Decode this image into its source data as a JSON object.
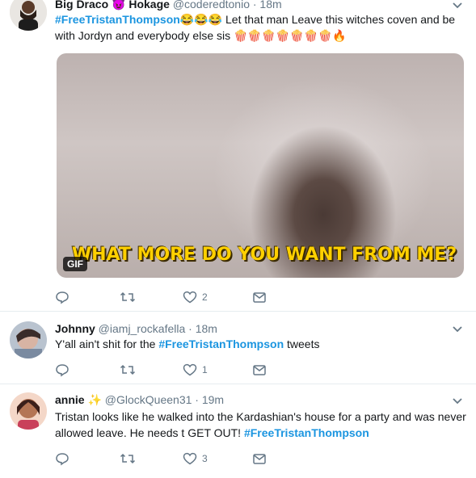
{
  "tweets": [
    {
      "name": "Big Draco",
      "name_emoji": "😈",
      "name_suffix": "Hokage",
      "handle": "@coderedtonio",
      "time": "· 18m",
      "hashtag": "#FreeTristanThompson",
      "text_emoji": "😂😂😂",
      "text": "Let that man Leave this witches coven and be",
      "text_line2": "with Jordyn and everybody else sis",
      "trailing_emoji": "🍿🍿🍿🍿🍿🍿🍿🔥",
      "media": {
        "caption": "WHAT MORE DO YOU WANT FROM ME?",
        "badge": "GIF"
      },
      "likes": "2"
    },
    {
      "name": "Johnny",
      "handle": "@iamj_rockafella",
      "time": "· 18m",
      "text_before": "Y'all ain't shit for the",
      "hashtag": "#FreeTristanThompson",
      "text_after": "tweets",
      "likes": "1"
    },
    {
      "name": "annie",
      "name_emoji": "✨",
      "handle": "@GlockQueen31",
      "time": "· 19m",
      "text_line1": "Tristan looks like he walked into the Kardashian's house for a party and was never",
      "text_line2": "allowed leave. He needs t GET OUT!",
      "hashtag": "#FreeTristanThompson",
      "likes": "3"
    }
  ],
  "colors": {
    "hashtag": "#1b95e0",
    "muted": "#657786",
    "border": "#e6ecf0"
  },
  "icons": [
    "reply-icon",
    "retweet-icon",
    "like-icon",
    "dm-icon",
    "chevron-down-icon"
  ]
}
